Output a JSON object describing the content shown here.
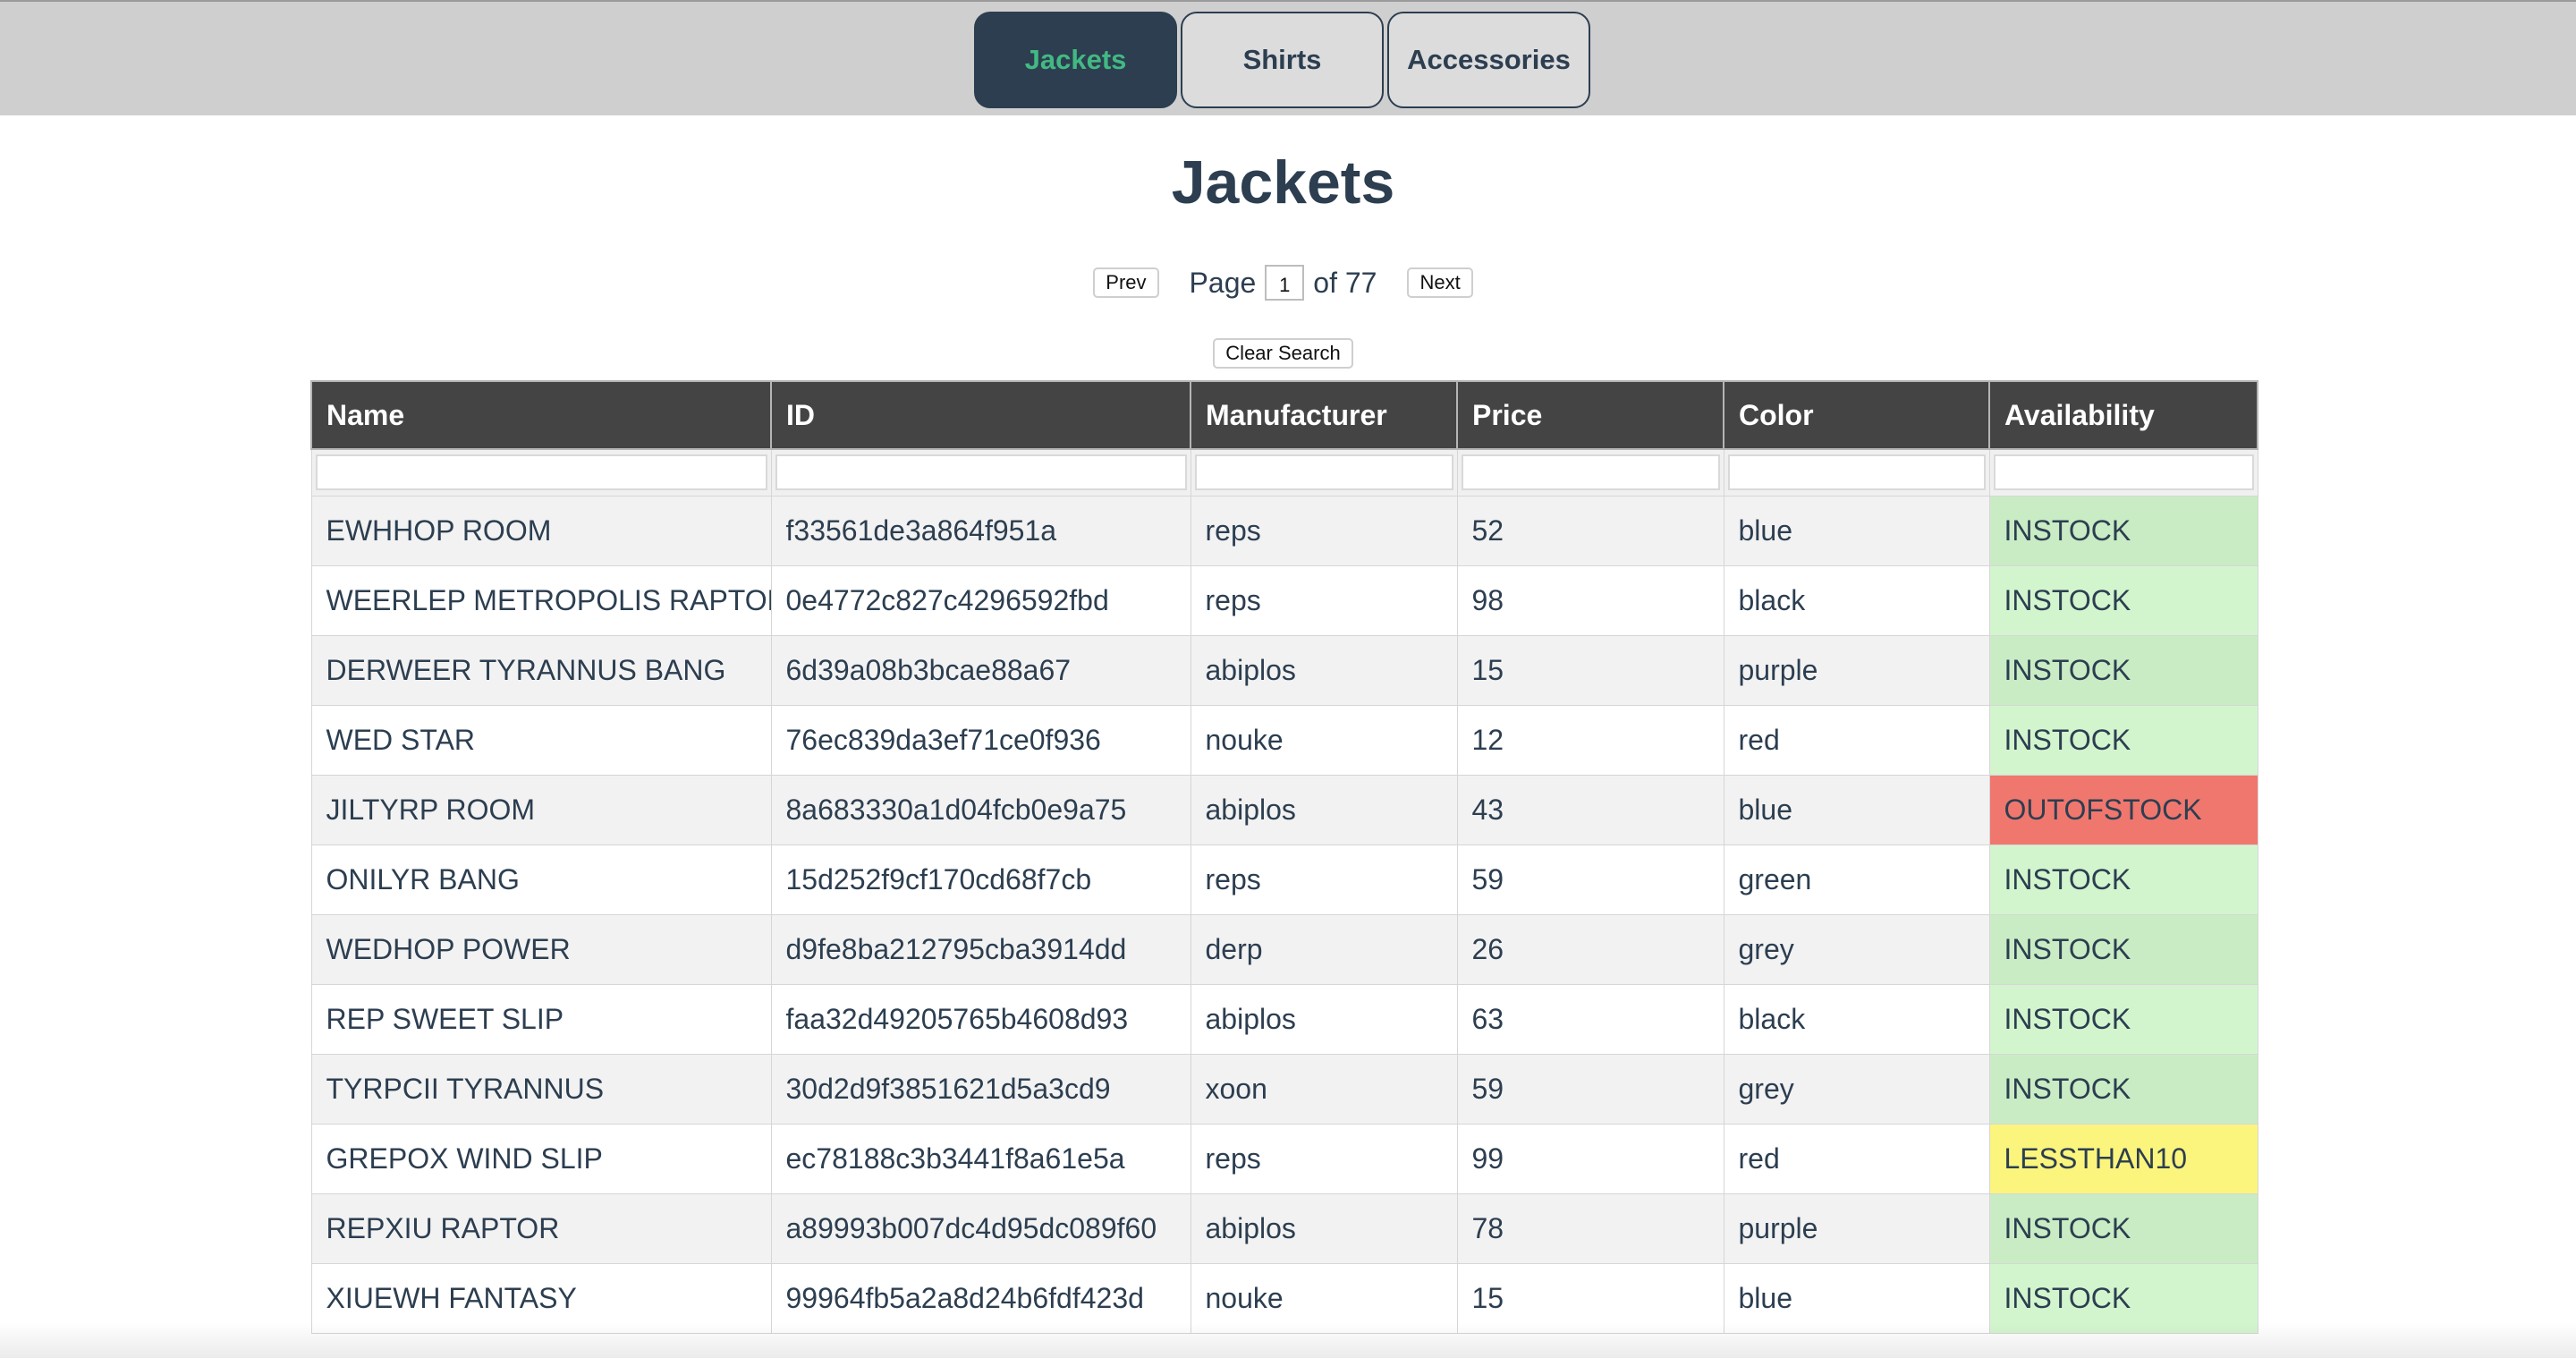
{
  "nav": {
    "tabs": [
      {
        "label": "Jackets",
        "active": true
      },
      {
        "label": "Shirts",
        "active": false
      },
      {
        "label": "Accessories",
        "active": false
      }
    ]
  },
  "heading": "Jackets",
  "pager": {
    "prev_label": "Prev",
    "page_label": "Page",
    "current_page": "1",
    "of_label": "of 77",
    "next_label": "Next"
  },
  "clear_search_label": "Clear Search",
  "table": {
    "columns": [
      "Name",
      "ID",
      "Manufacturer",
      "Price",
      "Color",
      "Availability"
    ],
    "rows": [
      {
        "name": "EWHHOP ROOM",
        "id": "f33561de3a864f951a",
        "manufacturer": "reps",
        "price": "52",
        "color": "blue",
        "availability": "INSTOCK"
      },
      {
        "name": "WEERLEP METROPOLIS RAPTOR",
        "id": "0e4772c827c4296592fbd",
        "manufacturer": "reps",
        "price": "98",
        "color": "black",
        "availability": "INSTOCK"
      },
      {
        "name": "DERWEER TYRANNUS BANG",
        "id": "6d39a08b3bcae88a67",
        "manufacturer": "abiplos",
        "price": "15",
        "color": "purple",
        "availability": "INSTOCK"
      },
      {
        "name": "WED STAR",
        "id": "76ec839da3ef71ce0f936",
        "manufacturer": "nouke",
        "price": "12",
        "color": "red",
        "availability": "INSTOCK"
      },
      {
        "name": "JILTYRP ROOM",
        "id": "8a683330a1d04fcb0e9a75",
        "manufacturer": "abiplos",
        "price": "43",
        "color": "blue",
        "availability": "OUTOFSTOCK"
      },
      {
        "name": "ONILYR BANG",
        "id": "15d252f9cf170cd68f7cb",
        "manufacturer": "reps",
        "price": "59",
        "color": "green",
        "availability": "INSTOCK"
      },
      {
        "name": "WEDHOP POWER",
        "id": "d9fe8ba212795cba3914dd",
        "manufacturer": "derp",
        "price": "26",
        "color": "grey",
        "availability": "INSTOCK"
      },
      {
        "name": "REP SWEET SLIP",
        "id": "faa32d49205765b4608d93",
        "manufacturer": "abiplos",
        "price": "63",
        "color": "black",
        "availability": "INSTOCK"
      },
      {
        "name": "TYRPCII TYRANNUS",
        "id": "30d2d9f3851621d5a3cd9",
        "manufacturer": "xoon",
        "price": "59",
        "color": "grey",
        "availability": "INSTOCK"
      },
      {
        "name": "GREPOX WIND SLIP",
        "id": "ec78188c3b3441f8a61e5a",
        "manufacturer": "reps",
        "price": "99",
        "color": "red",
        "availability": "LESSTHAN10"
      },
      {
        "name": "REPXIU RAPTOR",
        "id": "a89993b007dc4d95dc089f60",
        "manufacturer": "abiplos",
        "price": "78",
        "color": "purple",
        "availability": "INSTOCK"
      },
      {
        "name": "XIUEWH FANTASY",
        "id": "99964fb5a2a8d24b6fdf423d",
        "manufacturer": "nouke",
        "price": "15",
        "color": "blue",
        "availability": "INSTOCK"
      }
    ]
  },
  "colors": {
    "nav_bg": "#cfcfcf",
    "tab_active_bg": "#2c3e50",
    "tab_active_text": "#42b983",
    "header_bg": "#444444",
    "instock": "#d3f5ce",
    "outofstock": "#f0776e",
    "lessthan10": "#fbf57d"
  }
}
